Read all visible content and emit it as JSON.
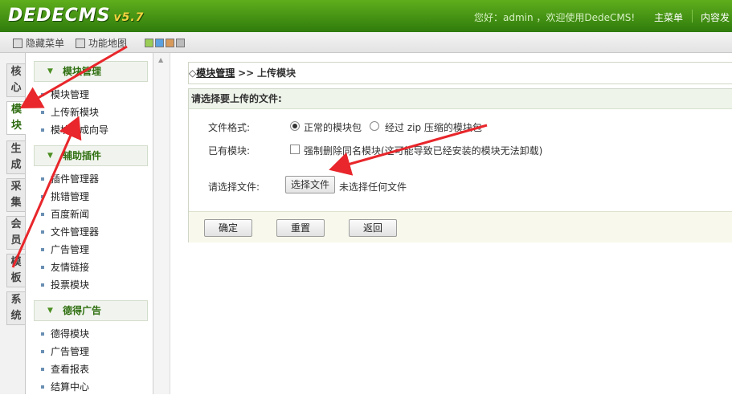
{
  "header": {
    "logo": "DEDECMS",
    "version": "v5.7",
    "welcome": "您好：admin ，欢迎使用DedeCMS!",
    "main_menu": "主菜单",
    "content_publish": "内容发"
  },
  "toolbar": {
    "hide_menu": "隐藏菜单",
    "function_map": "功能地图"
  },
  "tabs": [
    "核心",
    "模块",
    "生成",
    "采集",
    "会员",
    "模板",
    "系统"
  ],
  "sidebar": {
    "groups": [
      {
        "title": "模块管理",
        "items": [
          "模块管理",
          "上传新模块",
          "模块生成向导"
        ]
      },
      {
        "title": "辅助插件",
        "items": [
          "插件管理器",
          "挑错管理",
          "百度新闻",
          "文件管理器",
          "广告管理",
          "友情链接",
          "投票模块"
        ]
      },
      {
        "title": "德得广告",
        "items": [
          "德得模块",
          "广告管理",
          "查看报表",
          "结算中心"
        ]
      }
    ]
  },
  "breadcrumb": {
    "root": "模块管理",
    "sep": ">>",
    "current": "上传模块"
  },
  "form": {
    "title": "请选择要上传的文件:",
    "format_label": "文件格式:",
    "format_option1": "正常的模块包",
    "format_option2": "经过 zip 压缩的模块包",
    "existing_label": "已有模块:",
    "existing_checkbox": "强制删除同名模块(这可能导致已经安装的模块无法卸载)",
    "file_label": "请选择文件:",
    "file_button": "选择文件",
    "file_status": "未选择任何文件",
    "confirm": "确定",
    "reset": "重置",
    "back": "返回"
  },
  "colors": {
    "header_green": "#3e8f14",
    "arrow_red": "#e8262b"
  }
}
